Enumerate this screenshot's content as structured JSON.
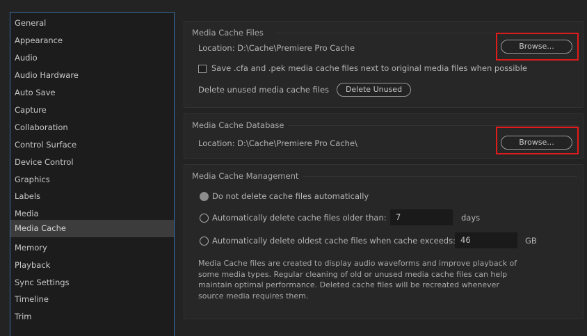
{
  "sidebar": {
    "items": [
      {
        "label": "General"
      },
      {
        "label": "Appearance"
      },
      {
        "label": "Audio"
      },
      {
        "label": "Audio Hardware"
      },
      {
        "label": "Auto Save"
      },
      {
        "label": "Capture"
      },
      {
        "label": "Collaboration"
      },
      {
        "label": "Control Surface"
      },
      {
        "label": "Device Control"
      },
      {
        "label": "Graphics"
      },
      {
        "label": "Labels"
      },
      {
        "label": "Media"
      },
      {
        "label": "Media Cache",
        "selected": true
      },
      {
        "label": "Memory"
      },
      {
        "label": "Playback"
      },
      {
        "label": "Sync Settings"
      },
      {
        "label": "Timeline"
      },
      {
        "label": "Trim"
      }
    ]
  },
  "media_cache_files": {
    "title": "Media Cache Files",
    "location": "Location:  D:\\Cache\\Premiere Pro Cache",
    "browse_label": "Browse...",
    "save_checkbox_label": "Save .cfa and .pek media cache files next to original media files when possible",
    "save_checkbox_checked": false,
    "delete_unused_text": "Delete unused media cache files",
    "delete_unused_label": "Delete Unused"
  },
  "media_cache_database": {
    "title": "Media Cache Database",
    "location": "Location:  D:\\Cache\\Premiere Pro Cache\\",
    "browse_label": "Browse..."
  },
  "media_cache_management": {
    "title": "Media Cache Management",
    "option_no_delete": "Do not delete cache files automatically",
    "option_older_than": "Automatically delete cache files older than:",
    "older_than_value": "7",
    "older_than_unit": "days",
    "option_exceeds": "Automatically delete oldest cache files when cache exceeds:",
    "exceeds_value": "46",
    "exceeds_unit": "GB",
    "selected_option": "no_delete",
    "description": [
      "Media Cache files are created to display audio waveforms and improve playback of",
      "some media types.  Regular cleaning of old or unused media cache files can help",
      "maintain optimal performance. Deleted cache files will be recreated whenever",
      "source media requires them."
    ]
  },
  "colors": {
    "highlight": "#e01b1b",
    "sidebar_border": "#3b6ea5"
  }
}
